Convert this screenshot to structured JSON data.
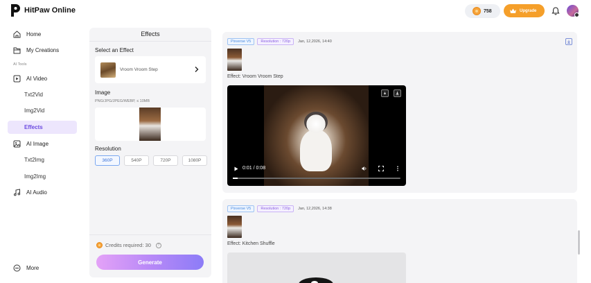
{
  "app": {
    "name": "HitPaw Online"
  },
  "topbar": {
    "credits": "758",
    "upgrade_label": "Upgrade"
  },
  "sidebar": {
    "home": "Home",
    "creations": "My Creations",
    "section_label": "AI Tools",
    "ai_video": "AI Video",
    "txt2vid": "Txt2Vid",
    "img2vid": "Img2Vid",
    "effects": "Effects",
    "ai_image": "AI Image",
    "txt2img": "Txt2Img",
    "img2img": "Img2Img",
    "ai_audio": "AI Audio",
    "more": "More"
  },
  "panel": {
    "title": "Effects",
    "select_label": "Select an Effect",
    "selected_effect": "Vroom Vroom Step",
    "image_label": "Image",
    "image_hint": "PNG/JPG/JPEG/WEBP, ≤ 10MB",
    "resolution_label": "Resolution",
    "resolutions": [
      "360P",
      "540P",
      "720P",
      "1080P"
    ],
    "selected_resolution": "360P",
    "credits_required": "Credits required: 30",
    "generate_label": "Generate"
  },
  "results": [
    {
      "model": "Pixverse V5",
      "resolution": "Resolution : 720p",
      "date": "Jan, 12,2026, 14:40",
      "effect": "Effect: Vroom Vroom Step",
      "video_time": "0:01 / 0:08",
      "progress": 0.03
    },
    {
      "model": "Pixverse V5",
      "resolution": "Resolution : 720p",
      "date": "Jan, 12,2026, 14:38",
      "effect": "Effect: Kitchen Shuffle"
    }
  ],
  "colors": {
    "accent": "#6b4ae0",
    "upgrade": "#f59f2a",
    "generate_start": "#e4a2f7",
    "generate_end": "#8c7cf7"
  }
}
